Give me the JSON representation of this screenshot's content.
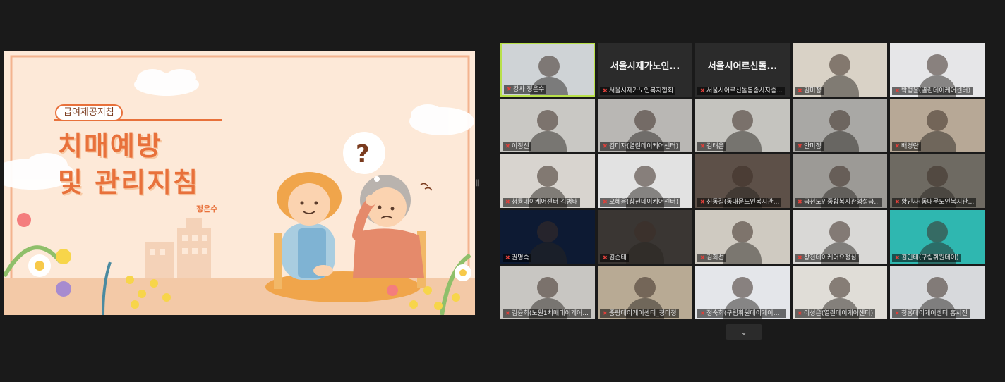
{
  "slide": {
    "tag": "급여제공지침",
    "title_line1": "치매예방",
    "title_line2": "및 관리지침",
    "author": "정은수",
    "question_mark": "?"
  },
  "gallery": {
    "tiles": [
      {
        "name": "강사 정은수",
        "kind": "video",
        "bg": "#cfd3d6",
        "active": true
      },
      {
        "name": "서울시재가노인복지협회",
        "kind": "org",
        "org_label": "서울시재가노인..."
      },
      {
        "name": "서울시어르신돌봄종사자종...",
        "kind": "org",
        "org_label": "서울시어르신돌..."
      },
      {
        "name": "김미정",
        "kind": "video",
        "bg": "#d9d2c6"
      },
      {
        "name": "박형윤(열린데이케어센터)",
        "kind": "video",
        "bg": "#e6e6e8"
      },
      {
        "name": "이정선",
        "kind": "video",
        "bg": "#c9c8c4"
      },
      {
        "name": "김미자(열린데이케어센터)",
        "kind": "video",
        "bg": "#b9b7b4"
      },
      {
        "name": "김태은",
        "kind": "video",
        "bg": "#c5c4bf"
      },
      {
        "name": "안미정",
        "kind": "video",
        "bg": "#a9a8a5"
      },
      {
        "name": "배경란",
        "kind": "video",
        "bg": "#b7a896"
      },
      {
        "name": "청룡데이케어센터 김병태",
        "kind": "video",
        "bg": "#d8d4cf"
      },
      {
        "name": "오혜윤(창천데이케어센터)",
        "kind": "video",
        "bg": "#e2e2e2"
      },
      {
        "name": "신동길(동대문노인복지관...",
        "kind": "video",
        "bg": "#5d5048"
      },
      {
        "name": "금천노인종합복지관행설금...",
        "kind": "video",
        "bg": "#9c9a96"
      },
      {
        "name": "황인자(동대문노인복지관...",
        "kind": "video",
        "bg": "#6e6a62"
      },
      {
        "name": "권명숙",
        "kind": "video",
        "bg": "#0d1a33"
      },
      {
        "name": "김순태",
        "kind": "video",
        "bg": "#3a3633"
      },
      {
        "name": "김희선",
        "kind": "video",
        "bg": "#cfcac1"
      },
      {
        "name": "창천데이케어요정심",
        "kind": "video",
        "bg": "#d9d8d6"
      },
      {
        "name": "김인태(구립휘원데이)",
        "kind": "video",
        "bg": "#2fb7b0"
      },
      {
        "name": "김윤희(노원1치매데이케어...",
        "kind": "video",
        "bg": "#c8c6c2"
      },
      {
        "name": "중랑데이케어센터_정다정",
        "kind": "video",
        "bg": "#b8aa94"
      },
      {
        "name": "정숙희(구립휘원데이케어센...",
        "kind": "video",
        "bg": "#e4e6ea"
      },
      {
        "name": "이성은(열린데이케어센터)",
        "kind": "video",
        "bg": "#e0ddd7"
      },
      {
        "name": "청룡데이케어센터 홍서진",
        "kind": "video",
        "bg": "#d7d9dc"
      }
    ]
  },
  "controls": {
    "more_chevron": "⌄",
    "mic_muted_icon": "mic-muted-icon"
  },
  "colors": {
    "accent_title": "#e8713b",
    "active_border": "#b8e04a",
    "muted_mic": "#e0403a"
  }
}
